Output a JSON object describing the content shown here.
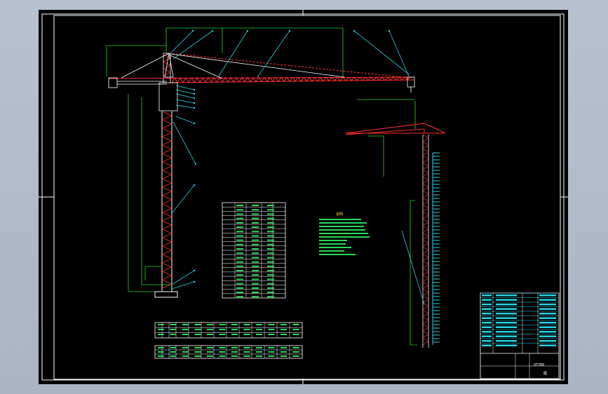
{
  "drawing": {
    "notes_heading": "说明",
    "table_a": {
      "header": [
        "",
        "16",
        "4"
      ]
    },
    "table_b": {
      "row1_label": "12",
      "row2_label": "14"
    },
    "title_block": {
      "sheet": "QTZ80",
      "sheet_no": "图"
    }
  },
  "colors": {
    "background": "#000000",
    "frame": "#ffffff",
    "crane_red": "#ff3030",
    "dimension_green": "#22d822",
    "leader_cyan": "#28d0e0",
    "text_yellow": "#e8e020"
  }
}
